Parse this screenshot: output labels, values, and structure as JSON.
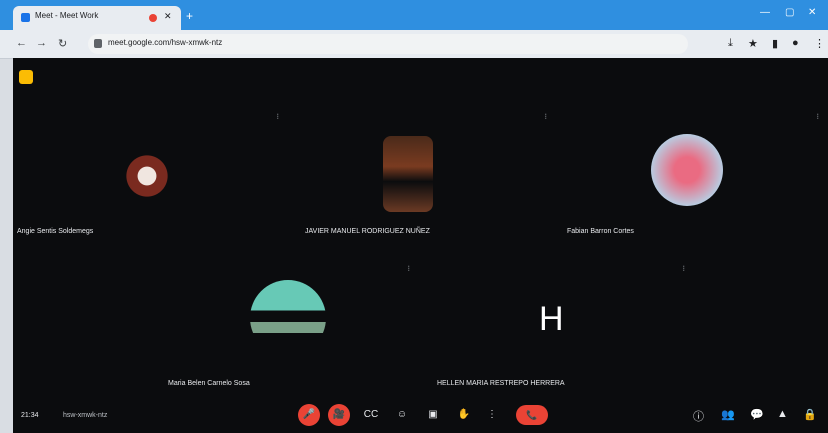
{
  "browser": {
    "tab_title": "Meet - Meet Work",
    "url": "meet.google.com/hsw-xmwk-ntz",
    "new_tab_symbol": "+",
    "close_tab_symbol": "✕"
  },
  "meeting": {
    "clock": "21:34",
    "meeting_code": "hsw-xmwk-ntz",
    "participants": [
      {
        "name": "Angie Sentis Soldemegs"
      },
      {
        "name": "JAVIER MANUEL RODRIGUEZ NUÑEZ"
      },
      {
        "name": "Fabian Barron Cortes"
      },
      {
        "name": "Maria Belen Carnelo Sosa"
      },
      {
        "name": "HELLEN MARIA RESTREPO HERRERA",
        "initial": "H"
      }
    ]
  },
  "controls": {
    "mic_label": "🎤",
    "camera_label": "🎥",
    "captions_label": "CC",
    "emoji_label": "☺",
    "present_label": "▣",
    "raise_hand_label": "✋",
    "more_label": "⋮",
    "hangup_label": "📞"
  },
  "colors": {
    "accent_red": "#ea4335",
    "browser_blue": "#2f8fe0",
    "stage_bg": "#0b0c0e"
  }
}
